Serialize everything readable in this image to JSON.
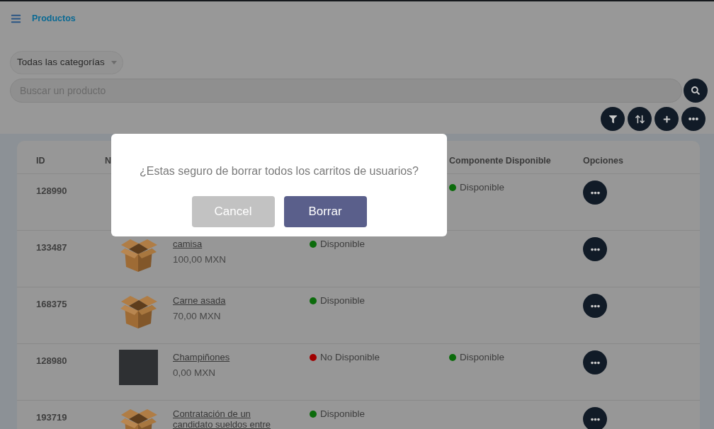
{
  "header": {
    "title": "Productos"
  },
  "filters": {
    "category": "Todas las categorías",
    "search_placeholder": "Buscar un producto"
  },
  "table": {
    "columns": {
      "id": "ID",
      "column_2": "N",
      "component": "Componente Disponible",
      "options": "Opciones"
    },
    "rows": [
      {
        "id": "128990",
        "component": {
          "label": "Disponible",
          "color": "#0b6b0b"
        }
      },
      {
        "id": "133487",
        "kind": "box",
        "name": "camisa",
        "price": "100,00 MXN",
        "availability": {
          "label": "Disponible",
          "color": "#0b6b0b"
        }
      },
      {
        "id": "168375",
        "kind": "box",
        "name": "Carne asada",
        "price": "70,00 MXN",
        "availability": {
          "label": "Disponible",
          "color": "#0b6b0b"
        }
      },
      {
        "id": "128980",
        "kind": "photo",
        "name": "Champiñones",
        "price": "0,00 MXN",
        "availability": {
          "label": "No Disponible",
          "color": "#a00000"
        },
        "component": {
          "label": "Disponible",
          "color": "#0b6b0b"
        }
      },
      {
        "id": "193719",
        "kind": "box",
        "name": "Contratación de un candidato sueldos entre",
        "availability": {
          "label": "Disponible",
          "color": "#0b6b0b"
        }
      }
    ]
  },
  "dialog": {
    "message": "¿Estas seguro de borrar todos los carritos de usuarios?",
    "buttons": [
      {
        "label": "Cancel",
        "kind": "secondary"
      },
      {
        "label": "Borrar",
        "kind": "primary"
      }
    ]
  }
}
